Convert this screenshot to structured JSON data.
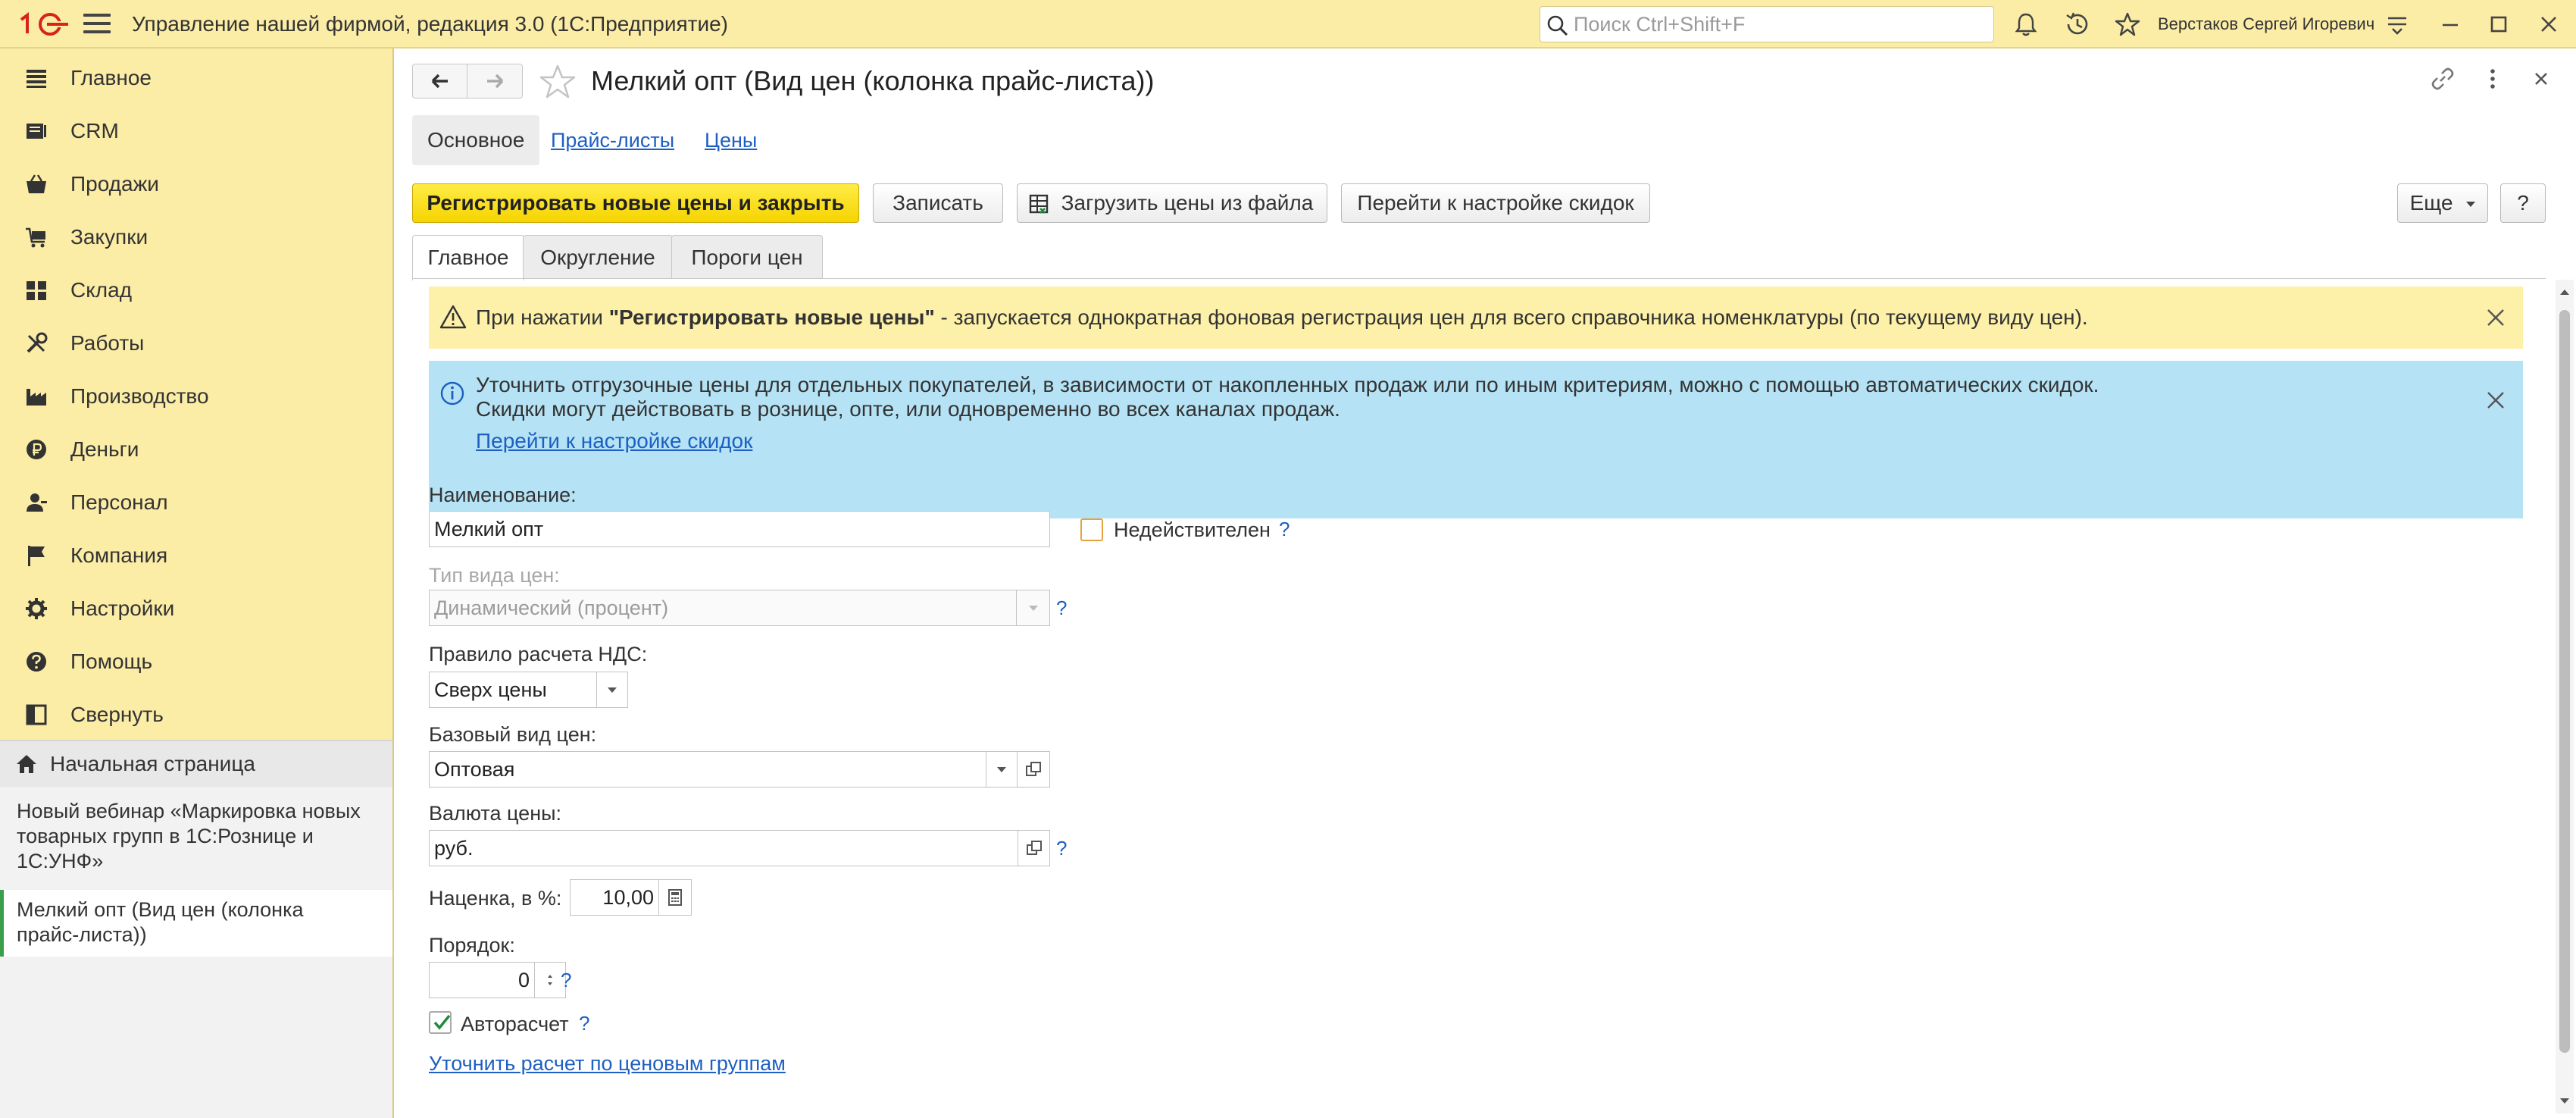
{
  "app": {
    "title": "Управление нашей фирмой, редакция 3.0  (1С:Предприятие)",
    "logo_text": "1С",
    "search_placeholder": "Поиск Ctrl+Shift+F",
    "user_name": "Верстаков Сергей Игоревич"
  },
  "sidebar": {
    "sections": [
      {
        "label": "Главное",
        "icon": "list-icon"
      },
      {
        "label": "CRM",
        "icon": "crm-icon"
      },
      {
        "label": "Продажи",
        "icon": "basket-icon"
      },
      {
        "label": "Закупки",
        "icon": "purchase-icon"
      },
      {
        "label": "Склад",
        "icon": "warehouse-icon"
      },
      {
        "label": "Работы",
        "icon": "tools-icon"
      },
      {
        "label": "Производство",
        "icon": "factory-icon"
      },
      {
        "label": "Деньги",
        "icon": "ruble-icon"
      },
      {
        "label": "Персонал",
        "icon": "person-icon"
      },
      {
        "label": "Компания",
        "icon": "flag-icon"
      },
      {
        "label": "Настройки",
        "icon": "gear-icon"
      },
      {
        "label": "Помощь",
        "icon": "help-icon"
      },
      {
        "label": "Свернуть",
        "icon": "collapse-icon"
      }
    ],
    "home": "Начальная страница",
    "open_windows": [
      "Новый вебинар «Маркировка новых товарных групп в 1С:Рознице и 1С:УНФ»",
      "Мелкий опт (Вид цен (колонка прайс-листа))"
    ]
  },
  "form": {
    "title": "Мелкий опт (Вид цен (колонка прайс-листа))",
    "tabs": [
      "Основное",
      "Прайс-листы",
      "Цены"
    ],
    "buttons": {
      "register": "Регистрировать новые цены и закрыть",
      "save": "Записать",
      "load": "Загрузить цены из файла",
      "discounts": "Перейти к настройке скидок",
      "more": "Еще",
      "help": "?"
    },
    "inner_tabs": [
      "Главное",
      "Округление",
      "Пороги цен"
    ],
    "warning": {
      "prefix": "При нажатии ",
      "bold": "\"Регистрировать новые цены\"",
      "suffix": " - запускается однократная фоновая регистрация цен для всего справочника номенклатуры (по текущему виду цен)."
    },
    "info": {
      "line1": "Уточнить отгрузочные цены для отдельных покупателей, в зависимости от накопленных продаж или по иным критериям, можно с помощью автоматических скидок.",
      "line2": "Скидки могут действовать в рознице, опте, или одновременно во всех каналах продаж.",
      "link": "Перейти к настройке скидок"
    },
    "fields": {
      "name_label": "Наименование:",
      "name_value": "Мелкий опт",
      "invalid_label": "Недействителен",
      "invalid_checked": false,
      "price_type_label": "Тип вида цен:",
      "price_type_value": "Динамический (процент)",
      "vat_label": "Правило расчета НДС:",
      "vat_value": "Сверх цены",
      "base_label": "Базовый вид цен:",
      "base_value": "Оптовая",
      "currency_label": "Валюта цены:",
      "currency_value": "руб.",
      "markup_label": "Наценка, в %:",
      "markup_value": "10,00",
      "order_label": "Порядок:",
      "order_value": "0",
      "autocalc_label": "Авторасчет",
      "autocalc_checked": true,
      "refine_link": "Уточнить расчет по ценовым группам",
      "help_mark": "?"
    }
  },
  "colors": {
    "accent_yellow": "#fbeca6",
    "primary_button": "#f5d400",
    "link_blue": "#1d5fc2",
    "info_bg": "#b5e3f5",
    "warning_bg": "#fdf0a8",
    "logo_red": "#d6231c"
  }
}
